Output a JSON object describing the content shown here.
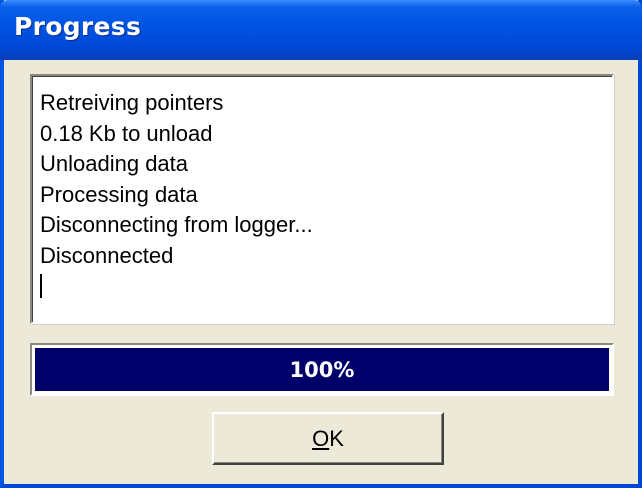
{
  "window": {
    "title": "Progress"
  },
  "log": {
    "lines": [
      "Retreiving pointers",
      "0.18 Kb to unload",
      "Unloading data",
      "Processing data",
      "Disconnecting from logger...",
      "Disconnected"
    ]
  },
  "progress": {
    "value": 1.0,
    "label": "100%",
    "fill_color": "#00006b"
  },
  "buttons": {
    "ok_mnemonic": "O",
    "ok_rest": "K"
  },
  "colors": {
    "titlebar": "#0055e5",
    "dialog_bg": "#ece9d8"
  }
}
